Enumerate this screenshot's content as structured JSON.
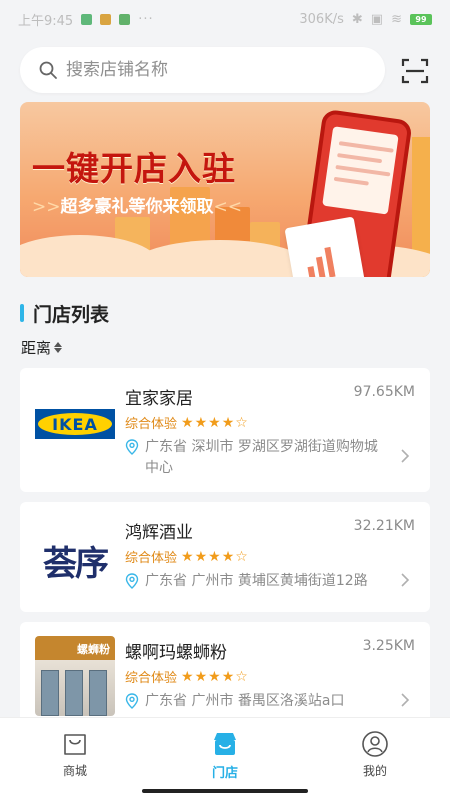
{
  "status_bar": {
    "time": "上午9:45",
    "network_speed": "306K/s",
    "battery": "99"
  },
  "search": {
    "placeholder": "搜索店铺名称",
    "value": ""
  },
  "banner": {
    "title": "一键开店入驻",
    "subtitle": "超多豪礼等你来领取",
    "chev_left": ">>",
    "chev_right": "<<"
  },
  "section": {
    "title": "门店列表",
    "sort_label": "距离"
  },
  "stores": [
    {
      "name": "宜家家居",
      "distance": "97.65KM",
      "rating_label": "综合体验",
      "stars": 4,
      "address": "广东省 深圳市 罗湖区罗湖街道购物城中心",
      "logo_text": "IKEA"
    },
    {
      "name": "鸿辉酒业",
      "distance": "32.21KM",
      "rating_label": "综合体验",
      "stars": 4,
      "address": "广东省 广州市 黄埔区黄埔街道12路",
      "logo_text": "荟序"
    },
    {
      "name": "螺啊玛螺蛳粉",
      "distance": "3.25KM",
      "rating_label": "综合体验",
      "stars": 4,
      "address": "广东省 广州市 番禺区洛溪站a口",
      "logo_text": "螺蛳粉"
    }
  ],
  "nav": {
    "items": [
      {
        "label": "商城",
        "icon": "bag-icon"
      },
      {
        "label": "门店",
        "icon": "store-icon"
      },
      {
        "label": "我的",
        "icon": "user-icon"
      }
    ],
    "active_index": 1
  },
  "colors": {
    "accent": "#27b0e6",
    "star": "#f19c1b",
    "banner_red": "#c4160e"
  }
}
